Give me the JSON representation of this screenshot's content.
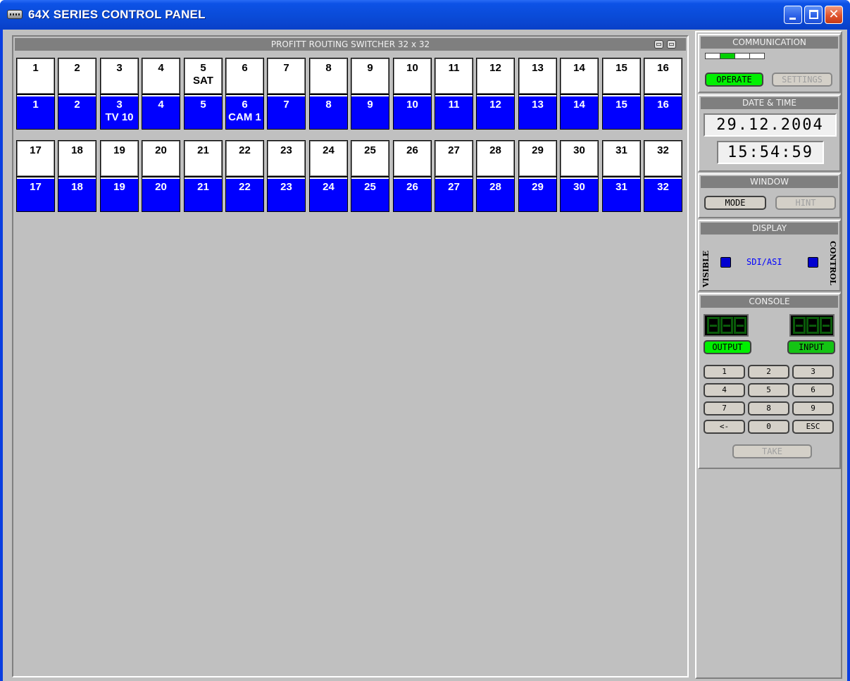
{
  "window": {
    "title": "64X SERIES CONTROL PANEL"
  },
  "main": {
    "header": "PROFITT ROUTING SWITCHER 32 x 32",
    "cells": [
      {
        "out": "1",
        "out_label": "",
        "in": "1",
        "in_label": ""
      },
      {
        "out": "2",
        "out_label": "",
        "in": "2",
        "in_label": ""
      },
      {
        "out": "3",
        "out_label": "",
        "in": "3",
        "in_label": "TV 10"
      },
      {
        "out": "4",
        "out_label": "",
        "in": "4",
        "in_label": ""
      },
      {
        "out": "5",
        "out_label": "SAT",
        "in": "5",
        "in_label": ""
      },
      {
        "out": "6",
        "out_label": "",
        "in": "6",
        "in_label": "CAM 1"
      },
      {
        "out": "7",
        "out_label": "",
        "in": "7",
        "in_label": ""
      },
      {
        "out": "8",
        "out_label": "",
        "in": "8",
        "in_label": ""
      },
      {
        "out": "9",
        "out_label": "",
        "in": "9",
        "in_label": ""
      },
      {
        "out": "10",
        "out_label": "",
        "in": "10",
        "in_label": ""
      },
      {
        "out": "11",
        "out_label": "",
        "in": "11",
        "in_label": ""
      },
      {
        "out": "12",
        "out_label": "",
        "in": "12",
        "in_label": ""
      },
      {
        "out": "13",
        "out_label": "",
        "in": "13",
        "in_label": ""
      },
      {
        "out": "14",
        "out_label": "",
        "in": "14",
        "in_label": ""
      },
      {
        "out": "15",
        "out_label": "",
        "in": "15",
        "in_label": ""
      },
      {
        "out": "16",
        "out_label": "",
        "in": "16",
        "in_label": ""
      },
      {
        "out": "17",
        "out_label": "",
        "in": "17",
        "in_label": ""
      },
      {
        "out": "18",
        "out_label": "",
        "in": "18",
        "in_label": ""
      },
      {
        "out": "19",
        "out_label": "",
        "in": "19",
        "in_label": ""
      },
      {
        "out": "20",
        "out_label": "",
        "in": "20",
        "in_label": ""
      },
      {
        "out": "21",
        "out_label": "",
        "in": "21",
        "in_label": ""
      },
      {
        "out": "22",
        "out_label": "",
        "in": "22",
        "in_label": ""
      },
      {
        "out": "23",
        "out_label": "",
        "in": "23",
        "in_label": ""
      },
      {
        "out": "24",
        "out_label": "",
        "in": "24",
        "in_label": ""
      },
      {
        "out": "25",
        "out_label": "",
        "in": "25",
        "in_label": ""
      },
      {
        "out": "26",
        "out_label": "",
        "in": "26",
        "in_label": ""
      },
      {
        "out": "27",
        "out_label": "",
        "in": "27",
        "in_label": ""
      },
      {
        "out": "28",
        "out_label": "",
        "in": "28",
        "in_label": ""
      },
      {
        "out": "29",
        "out_label": "",
        "in": "29",
        "in_label": ""
      },
      {
        "out": "30",
        "out_label": "",
        "in": "30",
        "in_label": ""
      },
      {
        "out": "31",
        "out_label": "",
        "in": "31",
        "in_label": ""
      },
      {
        "out": "32",
        "out_label": "",
        "in": "32",
        "in_label": ""
      }
    ]
  },
  "communication": {
    "header": "COMMUNICATION",
    "leds": [
      false,
      true,
      false,
      false
    ],
    "operate": "OPERATE",
    "settings": "SETTINGS"
  },
  "datetime": {
    "header": "DATE & TIME",
    "date": "29.12.2004",
    "time": "15:54:59"
  },
  "window_sec": {
    "header": "WINDOW",
    "mode": "MODE",
    "hint": "HINT"
  },
  "display": {
    "header": "DISPLAY",
    "visible": "VISIBLE",
    "signal": "SDI/ASI",
    "control": "CONTROL"
  },
  "console": {
    "header": "CONSOLE",
    "output": "OUTPUT",
    "input": "INPUT",
    "keys": [
      "1",
      "2",
      "3",
      "4",
      "5",
      "6",
      "7",
      "8",
      "9",
      "<-",
      "0",
      "ESC"
    ],
    "take": "TAKE"
  },
  "colors": {
    "titlebar": "#0a4bd8",
    "input_cell": "#0000ff",
    "operate_green": "#00f000"
  }
}
